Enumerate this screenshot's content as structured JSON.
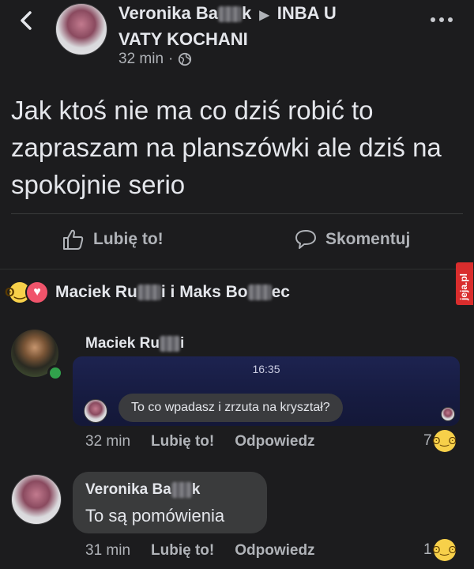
{
  "post": {
    "author_name": "Veronika Ba",
    "author_name_end": "k",
    "group_arrow": "▶",
    "group_name_line1": "INBA U",
    "group_name_line2": "VATY KOCHANI",
    "time": "32 min",
    "dot": "·",
    "body": "Jak ktoś nie ma co dziś robić to zapraszam na planszówki ale dziś na spokojnie serio",
    "like_label": "Lubię to!",
    "comment_label": "Skomentuj"
  },
  "reactions_summary": {
    "names_a": "Maciek Ru",
    "names_b": "i i Maks Bo",
    "names_c": "ec"
  },
  "watermark": "jeja.pl",
  "comments": [
    {
      "author_a": "Maciek Ru",
      "author_b": "i",
      "chat_time": "16:35",
      "chat_message": "To co wpadasz i zrzuta na kryształ?",
      "time": "32 min",
      "like_label": "Lubię to!",
      "reply_label": "Odpowiedz",
      "reaction_count": "7"
    },
    {
      "author_a": "Veronika Ba",
      "author_b": "k",
      "text": "To są pomówienia",
      "time": "31 min",
      "like_label": "Lubię to!",
      "reply_label": "Odpowiedz",
      "reaction_count": "1"
    }
  ],
  "icons": {
    "back": "chevron-left-icon",
    "more": "more-icon",
    "globe": "globe-icon",
    "like": "thumbs-up-icon",
    "comment": "comment-icon",
    "haha": "haha-reaction-icon",
    "love": "love-reaction-icon"
  }
}
